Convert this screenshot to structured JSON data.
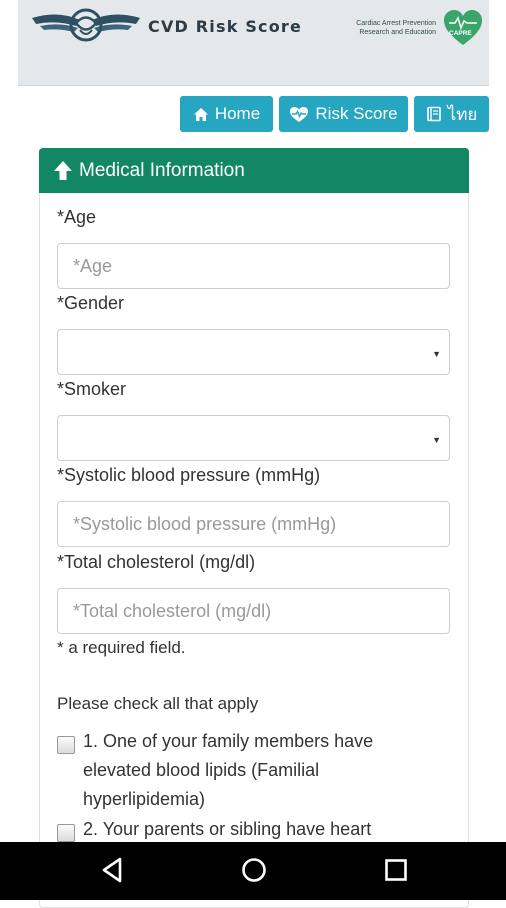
{
  "header": {
    "app_title": "CVD Risk Score",
    "org_text_line1": "Cardiac Arrest Prevention",
    "org_text_line2": "Research and Education",
    "org_badge": "CAPRE"
  },
  "nav": {
    "home_label": "Home",
    "risk_score_label": "Risk Score",
    "language_label": "ไทย"
  },
  "panel": {
    "heading": "Medical Information"
  },
  "form": {
    "age_label": "*Age",
    "age_placeholder": "*Age",
    "gender_label": "*Gender",
    "gender_value": "",
    "smoker_label": "*Smoker",
    "smoker_value": "",
    "sbp_label": "*Systolic blood pressure (mmHg)",
    "sbp_placeholder": "*Systolic blood pressure (mmHg)",
    "chol_label": "*Total cholesterol (mg/dl)",
    "chol_placeholder": "*Total cholesterol (mg/dl)",
    "required_note": "* a required field.",
    "check_intro": "Please check all that apply",
    "checks": [
      {
        "text": "1. One of your family members have elevated blood lipids (Familial hyperlipidemia)",
        "checked": false
      },
      {
        "text": "2. Your parents or sibling have heart",
        "checked": false
      }
    ]
  },
  "colors": {
    "header_bg": "#e4e8ea",
    "nav_button": "#26a6c0",
    "panel_heading": "#118763",
    "capre_green": "#3aa56b"
  },
  "icons": {
    "home": "home-icon",
    "risk": "heartbeat-icon",
    "language": "book-icon",
    "panel": "arrow-up-icon"
  }
}
